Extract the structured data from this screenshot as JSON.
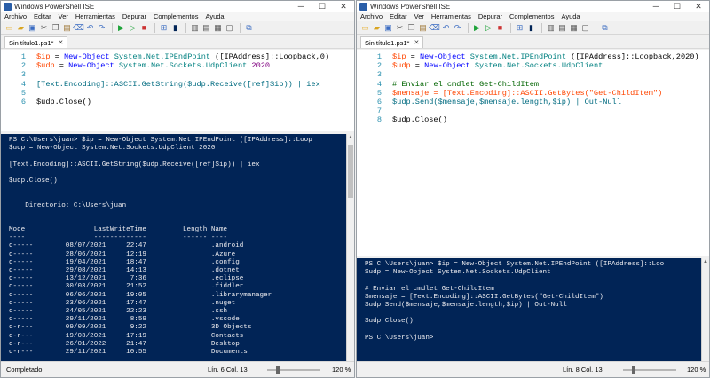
{
  "left": {
    "title": "Windows PowerShell ISE",
    "menu": [
      "Archivo",
      "Editar",
      "Ver",
      "Herramientas",
      "Depurar",
      "Complementos",
      "Ayuda"
    ],
    "tab_label": "Sin título1.ps1*",
    "script_lines": [
      "1",
      "2",
      "3",
      "4",
      "5",
      "6"
    ],
    "console_lines": [
      "PS C:\\Users\\juan> $ip = New-Object System.Net.IPEndPoint ([IPAddress]::Loop",
      "$udp = New-Object System.Net.Sockets.UdpClient 2020",
      "",
      "[Text.Encoding]::ASCII.GetString($udp.Receive([ref]$ip)) | iex",
      "",
      "$udp.Close()",
      "",
      "",
      "    Directorio: C:\\Users\\juan",
      "",
      "",
      "Mode                 LastWriteTime         Length Name",
      "----                 -------------         ------ ----",
      "d-----        08/07/2021     22:47                .android",
      "d-----        28/06/2021     12:19                .Azure",
      "d-----        19/04/2021     18:47                .config",
      "d-----        29/08/2021     14:13                .dotnet",
      "d-----        13/12/2021      7:36                .eclipse",
      "d-----        30/03/2021     21:52                .fiddler",
      "d-----        06/06/2021     19:05                .librarymanager",
      "d-----        23/06/2021     17:47                .nuget",
      "d-----        24/05/2021     22:23                .ssh",
      "d-----        29/11/2021      8:59                .vscode",
      "d-r---        09/09/2021      9:22                3D Objects",
      "d-r---        19/03/2021     17:19                Contacts",
      "d-r---        26/01/2022     21:47                Desktop",
      "d-r---        29/11/2021     10:55                Documents"
    ],
    "status": "Completado",
    "position": "Lín. 6  Col. 13",
    "zoom": "120 %"
  },
  "right": {
    "title": "Windows PowerShell ISE",
    "menu": [
      "Archivo",
      "Editar",
      "Ver",
      "Herramientas",
      "Depurar",
      "Complementos",
      "Ayuda"
    ],
    "tab_label": "Sin título1.ps1*",
    "script_lines": [
      "1",
      "2",
      "3",
      "4",
      "5",
      "6",
      "7",
      "8"
    ],
    "console_lines": [
      "PS C:\\Users\\juan> $ip = New-Object System.Net.IPEndPoint ([IPAddress]::Loo",
      "$udp = New-Object System.Net.Sockets.UdpClient",
      "",
      "# Enviar el cmdlet Get-ChildItem",
      "$mensaje = [Text.Encoding]::ASCII.GetBytes(\"Get-ChildItem\")",
      "$udp.Send($mensaje,$mensaje.length,$ip) | Out-Null",
      "",
      "$udp.Close()",
      "",
      "PS C:\\Users\\juan>"
    ],
    "status": "",
    "position": "Lín. 8  Col. 13",
    "zoom": "120 %"
  },
  "icons": [
    "new-icon",
    "open-icon",
    "save-icon",
    "cut-icon",
    "copy-icon",
    "paste-icon",
    "clear-icon",
    "undo-icon",
    "redo-icon",
    "run-icon",
    "run-selection-icon",
    "stop-icon",
    "remote-icon",
    "start-powershell-icon",
    "layout-icon",
    "help-icon"
  ],
  "code": {
    "left": {
      "l1_prefix": "$ip",
      "l1_mid": " = ",
      "l1_cmd": "New-Object",
      "l1_type": " System.Net.IPEndPoint",
      "l1_rest": " ([IPAddress]::Loopback,0)",
      "l2_prefix": "$udp",
      "l2_mid": " = ",
      "l2_cmd": "New-Object",
      "l2_type": " System.Net.Sockets.UdpClient",
      "l2_num": " 2020",
      "l4": "[Text.Encoding]::ASCII.GetString($udp.Receive([ref]$ip)) | iex",
      "l6": "$udp.Close()"
    },
    "right": {
      "l1_prefix": "$ip",
      "l1_mid": " = ",
      "l1_cmd": "New-Object",
      "l1_type": " System.Net.IPEndPoint",
      "l1_rest": " ([IPAddress]::Loopback,2020)",
      "l2_prefix": "$udp",
      "l2_mid": " = ",
      "l2_cmd": "New-Object",
      "l2_type": " System.Net.Sockets.UdpClient",
      "l4": "# Enviar el cmdlet Get-ChildItem",
      "l5": "$mensaje = [Text.Encoding]::ASCII.GetBytes(\"Get-ChildItem\")",
      "l6": "$udp.Send($mensaje,$mensaje.length,$ip) | Out-Null",
      "l8": "$udp.Close()"
    }
  }
}
